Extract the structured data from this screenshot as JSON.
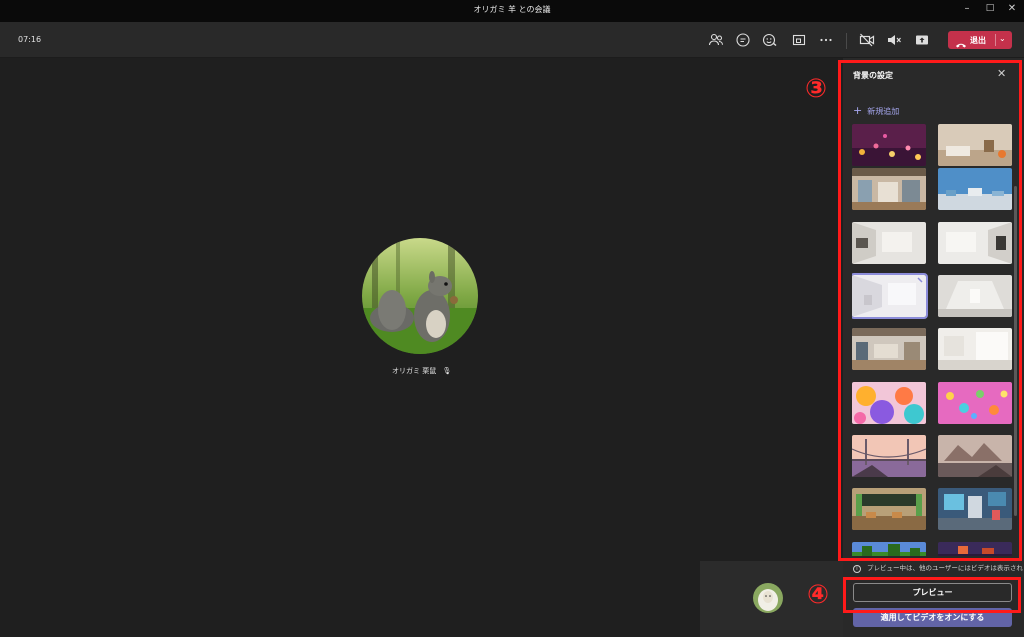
{
  "window": {
    "title": "オリガミ 羊 との会議",
    "controls": [
      "minimize-icon",
      "maximize-icon",
      "close-icon"
    ]
  },
  "toolbar": {
    "time": "07:16",
    "icons": [
      "people-icon",
      "chat-icon",
      "reactions-icon",
      "share-tray-icon",
      "more-icon",
      "camera-off-icon",
      "mic-muted-icon",
      "share-screen-icon"
    ],
    "leave_label": "退出",
    "leave_color": "#c4314b"
  },
  "stage": {
    "participant_name": "オリガミ 栗鼠",
    "participant_mic": "mic-off-icon"
  },
  "annotations": {
    "badge_3": "③",
    "badge_4": "④",
    "color": "#ff1a1a"
  },
  "panel": {
    "title": "背景の設定",
    "add_new": "新規追加",
    "backgrounds": [
      {
        "name": "purple-bokeh",
        "icon": "background-thumbnail"
      },
      {
        "name": "cozy-room",
        "icon": "background-thumbnail"
      },
      {
        "name": "office-loft",
        "icon": "background-thumbnail"
      },
      {
        "name": "city-skyline",
        "icon": "background-thumbnail"
      },
      {
        "name": "white-room-left",
        "icon": "background-thumbnail"
      },
      {
        "name": "white-room-right",
        "icon": "background-thumbnail"
      },
      {
        "name": "bright-atrium",
        "icon": "background-thumbnail",
        "selected": true
      },
      {
        "name": "minimal-gallery",
        "icon": "background-thumbnail"
      },
      {
        "name": "open-office",
        "icon": "background-thumbnail"
      },
      {
        "name": "empty-studio",
        "icon": "background-thumbnail"
      },
      {
        "name": "balloons-orange",
        "icon": "background-thumbnail"
      },
      {
        "name": "balloons-pink",
        "icon": "background-thumbnail"
      },
      {
        "name": "bridge-sunset",
        "icon": "background-thumbnail"
      },
      {
        "name": "desert-ruins",
        "icon": "background-thumbnail"
      },
      {
        "name": "minecraft-classroom",
        "icon": "background-thumbnail"
      },
      {
        "name": "minecraft-lab",
        "icon": "background-thumbnail"
      },
      {
        "name": "minecraft-forest",
        "icon": "background-thumbnail"
      },
      {
        "name": "minecraft-nether",
        "icon": "background-thumbnail"
      }
    ],
    "info_text": "プレビュー中は、他のユーザーにはビデオは表示されません。",
    "preview_label": "プレビュー",
    "apply_label": "適用してビデオをオンにする",
    "accent": "#6264a7"
  }
}
